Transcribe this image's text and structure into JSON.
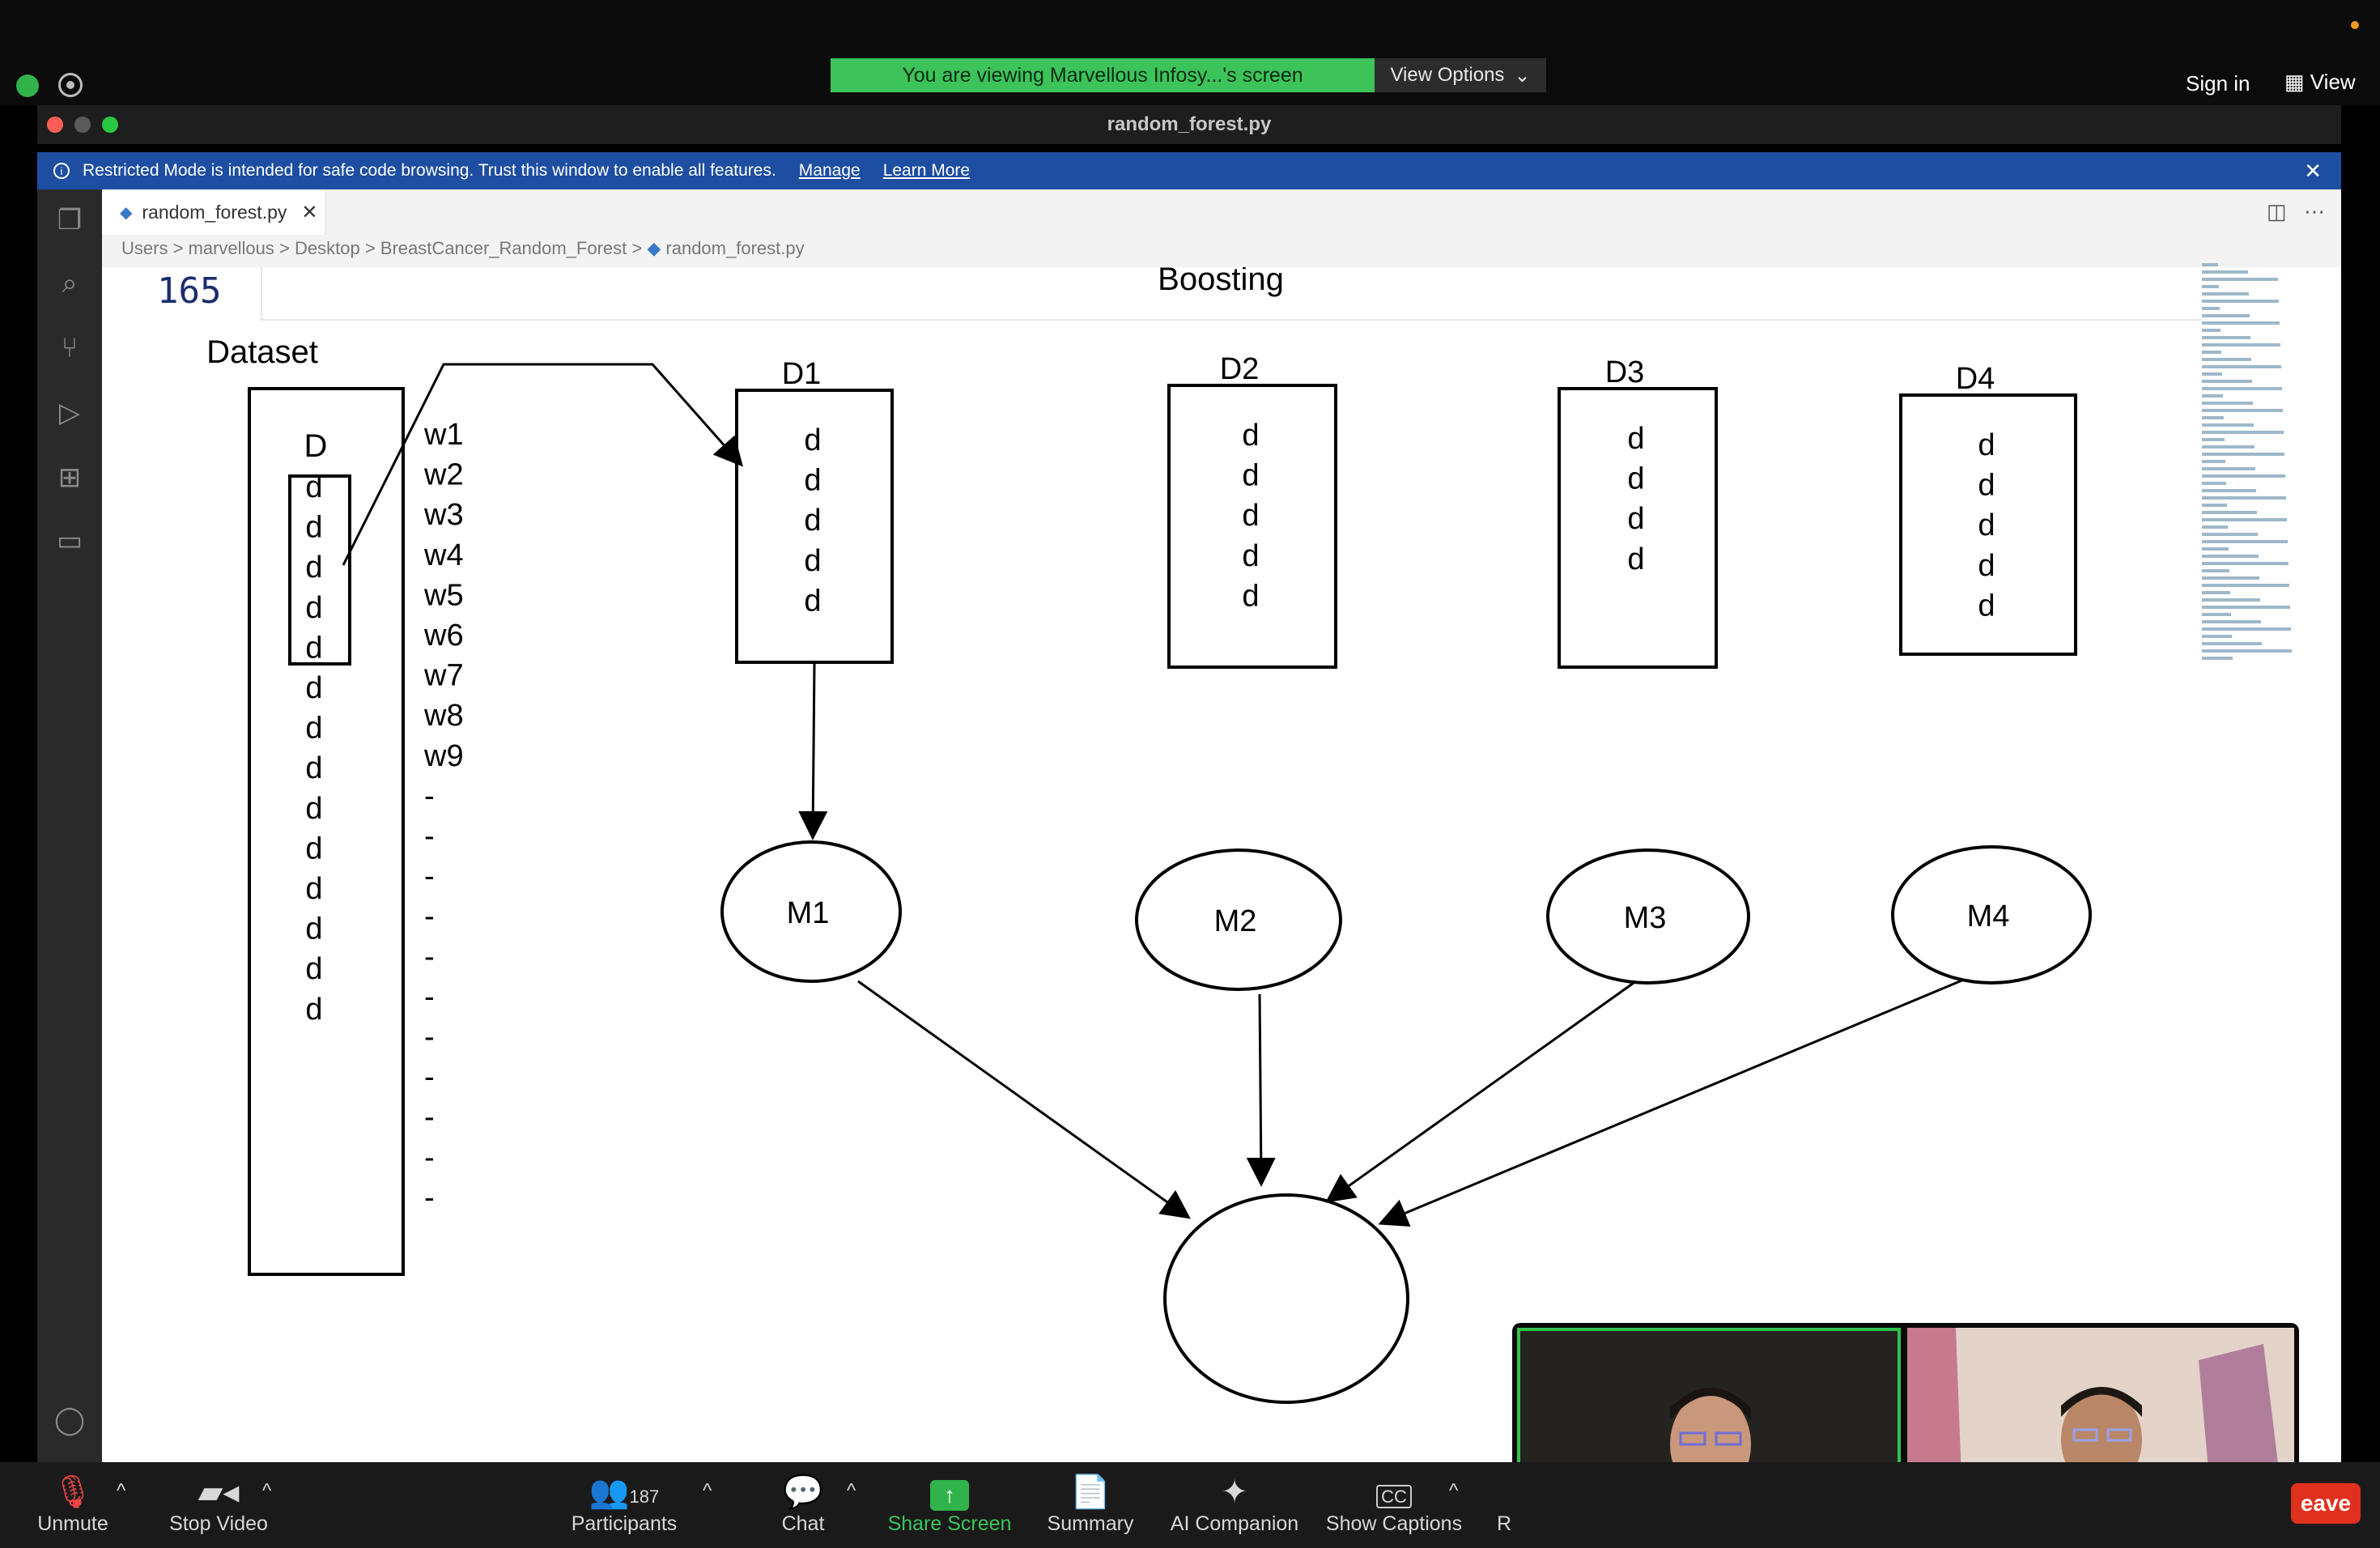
{
  "zoom": {
    "viewing_banner": "You are viewing Marvellous Infosy...'s screen",
    "view_options": "View Options",
    "sign_in": "Sign in",
    "view": "View"
  },
  "window": {
    "title": "random_forest.py"
  },
  "restricted": {
    "message": "Restricted Mode is intended for safe code browsing. Trust this window to enable all features.",
    "manage": "Manage",
    "learn_more": "Learn More"
  },
  "editor": {
    "tab_label": "random_forest.py",
    "breadcrumb": [
      "Users",
      "marvellous",
      "Desktop",
      "BreastCancer_Random_Forest",
      "random_forest.py"
    ],
    "line_number": "165"
  },
  "diagram": {
    "title": "Boosting",
    "dataset_label": "Dataset",
    "dataset_header": "D",
    "dataset_rows": [
      "d",
      "d",
      "d",
      "d",
      "d",
      "d",
      "d",
      "d",
      "d",
      "d",
      "d",
      "d",
      "d",
      "d"
    ],
    "weights": [
      "w1",
      "w2",
      "w3",
      "w4",
      "w5",
      "w6",
      "w7",
      "w8",
      "w9",
      "-",
      "-",
      "-",
      "-",
      "-",
      "-",
      "-",
      "-",
      "-",
      "-",
      "-"
    ],
    "subsets": [
      {
        "label": "D1",
        "rows": [
          "d",
          "d",
          "d",
          "d",
          "d"
        ]
      },
      {
        "label": "D2",
        "rows": [
          "d",
          "d",
          "d",
          "d",
          "d"
        ]
      },
      {
        "label": "D3",
        "rows": [
          "d",
          "d",
          "d",
          "d"
        ]
      },
      {
        "label": "D4",
        "rows": [
          "d",
          "d",
          "d",
          "d",
          "d"
        ]
      }
    ],
    "models": [
      "M1",
      "M2",
      "M3",
      "M4"
    ]
  },
  "toolbar": {
    "unmute": "Unmute",
    "stop_video": "Stop Video",
    "participants": "Participants",
    "participants_count": "187",
    "chat": "Chat",
    "share_screen": "Share Screen",
    "summary": "Summary",
    "ai_companion": "AI Companion",
    "show_captions": "Show Captions",
    "record": "R",
    "leave": "eave"
  },
  "colors": {
    "banner_green": "#3cc35a",
    "restricted_blue": "#1d4ea1",
    "leave_red": "#e0301e"
  }
}
